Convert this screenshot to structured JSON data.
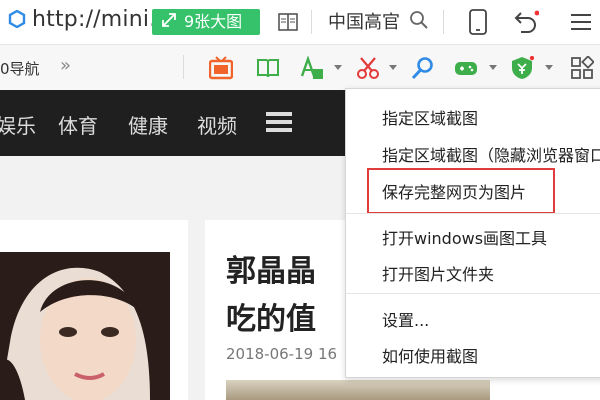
{
  "address_bar": {
    "url": "http://mini.",
    "big_pic_button": "9张大图",
    "search_text": "中国高官"
  },
  "toolbar": {
    "nav_label": "0导航",
    "more": "»"
  },
  "site_nav": {
    "items": [
      "娱乐",
      "体育",
      "健康",
      "视频"
    ]
  },
  "article": {
    "headline_line1": "郭晶晶",
    "headline_line2": "吃的值",
    "date": "2018-06-19 16"
  },
  "dropdown_menu": {
    "items": [
      "指定区域截图",
      "指定区域截图（隐藏浏览器窗口）",
      "保存完整网页为图片",
      "打开windows画图工具",
      "打开图片文件夹",
      "设置...",
      "如何使用截图"
    ],
    "highlighted_item_index": 2
  },
  "colors": {
    "accent_green": "#35c26a",
    "highlight_red": "#e03c3c",
    "nav_dark": "#1f1f1f",
    "icon_blue": "#2f8be6",
    "tv_orange": "#f0642c"
  }
}
